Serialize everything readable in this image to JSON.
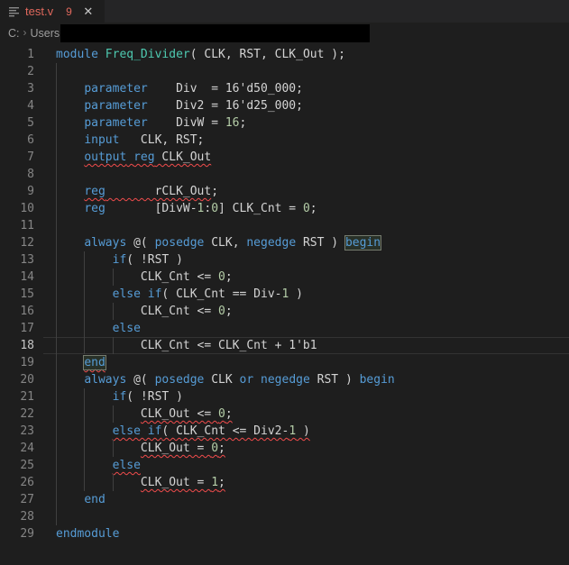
{
  "tab_bar": {
    "tab": {
      "file_name": "test.v",
      "problems_count": "9",
      "close_glyph": "✕"
    }
  },
  "breadcrumb": {
    "drive": "C:",
    "separator": "›",
    "folder": "Users",
    "redacted": true
  },
  "colors": {
    "editor_background": "#1e1e1e",
    "tab_bar_background": "#252526",
    "error_file_label": "#e0685c",
    "keyword": "#569cd6",
    "module_name": "#4ec9b0",
    "default_text": "#d4d4d4",
    "number": "#b5cea8",
    "squiggle": "#f14c4c",
    "line_number": "#858585",
    "line_number_active": "#c6c6c6",
    "indent_guide": "#404040"
  },
  "editor": {
    "language": "verilog",
    "current_line": 18,
    "lines": [
      {
        "n": 1,
        "ind": 0,
        "guides": 0,
        "tokens": [
          {
            "t": "module ",
            "c": "kw"
          },
          {
            "t": "Freq_Divider",
            "c": "fn"
          },
          {
            "t": "( CLK, RST, CLK_Out );",
            "c": "tx"
          }
        ]
      },
      {
        "n": 2,
        "ind": 0,
        "guides": 1,
        "tokens": []
      },
      {
        "n": 3,
        "ind": 4,
        "guides": 1,
        "tokens": [
          {
            "t": "parameter",
            "c": "kw"
          },
          {
            "t": "    Div  = 16'd50_000;",
            "c": "tx"
          }
        ]
      },
      {
        "n": 4,
        "ind": 4,
        "guides": 1,
        "tokens": [
          {
            "t": "parameter",
            "c": "kw"
          },
          {
            "t": "    Div2 = 16'd25_000;",
            "c": "tx"
          }
        ]
      },
      {
        "n": 5,
        "ind": 4,
        "guides": 1,
        "tokens": [
          {
            "t": "parameter",
            "c": "kw"
          },
          {
            "t": "    DivW = ",
            "c": "tx"
          },
          {
            "t": "16",
            "c": "nu"
          },
          {
            "t": ";",
            "c": "tx"
          }
        ]
      },
      {
        "n": 6,
        "ind": 4,
        "guides": 1,
        "tokens": [
          {
            "t": "input",
            "c": "kw"
          },
          {
            "t": "   CLK, RST;",
            "c": "tx"
          }
        ]
      },
      {
        "n": 7,
        "ind": 4,
        "guides": 1,
        "tokens": [
          {
            "t": "output",
            "c": "kw",
            "err": true
          },
          {
            "t": " ",
            "c": "tx",
            "err": true
          },
          {
            "t": "reg",
            "c": "kw",
            "err": true
          },
          {
            "t": " CLK_Out",
            "c": "tx",
            "err": true
          }
        ]
      },
      {
        "n": 8,
        "ind": 0,
        "guides": 1,
        "tokens": []
      },
      {
        "n": 9,
        "ind": 4,
        "guides": 1,
        "tokens": [
          {
            "t": "reg",
            "c": "kw",
            "err": true
          },
          {
            "t": "       rCLK_Out",
            "c": "tx",
            "err": true
          },
          {
            "t": ";",
            "c": "tx"
          }
        ]
      },
      {
        "n": 10,
        "ind": 4,
        "guides": 1,
        "tokens": [
          {
            "t": "reg",
            "c": "kw"
          },
          {
            "t": "       [DivW-",
            "c": "tx"
          },
          {
            "t": "1",
            "c": "nu"
          },
          {
            "t": ":",
            "c": "tx"
          },
          {
            "t": "0",
            "c": "nu"
          },
          {
            "t": "] CLK_Cnt = ",
            "c": "tx"
          },
          {
            "t": "0",
            "c": "nu"
          },
          {
            "t": ";",
            "c": "tx"
          }
        ]
      },
      {
        "n": 11,
        "ind": 0,
        "guides": 1,
        "tokens": []
      },
      {
        "n": 12,
        "ind": 4,
        "guides": 1,
        "tokens": [
          {
            "t": "always",
            "c": "kw"
          },
          {
            "t": " @( ",
            "c": "tx"
          },
          {
            "t": "posedge",
            "c": "kw"
          },
          {
            "t": " CLK, ",
            "c": "tx"
          },
          {
            "t": "negedge",
            "c": "kw"
          },
          {
            "t": " RST ) ",
            "c": "tx"
          },
          {
            "t": "begin",
            "c": "kw",
            "box": true
          }
        ]
      },
      {
        "n": 13,
        "ind": 8,
        "guides": 2,
        "tokens": [
          {
            "t": "if",
            "c": "kw"
          },
          {
            "t": "( !RST )",
            "c": "tx"
          }
        ]
      },
      {
        "n": 14,
        "ind": 12,
        "guides": 3,
        "tokens": [
          {
            "t": "CLK_Cnt <= ",
            "c": "tx"
          },
          {
            "t": "0",
            "c": "nu"
          },
          {
            "t": ";",
            "c": "tx"
          }
        ]
      },
      {
        "n": 15,
        "ind": 8,
        "guides": 2,
        "tokens": [
          {
            "t": "else if",
            "c": "kw"
          },
          {
            "t": "( CLK_Cnt == Div-",
            "c": "tx"
          },
          {
            "t": "1",
            "c": "nu"
          },
          {
            "t": " )",
            "c": "tx"
          }
        ]
      },
      {
        "n": 16,
        "ind": 12,
        "guides": 3,
        "tokens": [
          {
            "t": "CLK_Cnt <= ",
            "c": "tx"
          },
          {
            "t": "0",
            "c": "nu"
          },
          {
            "t": ";",
            "c": "tx"
          }
        ]
      },
      {
        "n": 17,
        "ind": 8,
        "guides": 2,
        "tokens": [
          {
            "t": "else",
            "c": "kw"
          }
        ]
      },
      {
        "n": 18,
        "ind": 12,
        "guides": 3,
        "tokens": [
          {
            "t": "CLK_Cnt <= CLK_Cnt + 1'b1",
            "c": "tx"
          }
        ]
      },
      {
        "n": 19,
        "ind": 4,
        "guides": 1,
        "tokens": [
          {
            "t": "end",
            "c": "kw",
            "err": true,
            "box": true
          }
        ]
      },
      {
        "n": 20,
        "ind": 4,
        "guides": 1,
        "tokens": [
          {
            "t": "always",
            "c": "kw"
          },
          {
            "t": " @( ",
            "c": "tx"
          },
          {
            "t": "posedge",
            "c": "kw"
          },
          {
            "t": " CLK ",
            "c": "tx"
          },
          {
            "t": "or",
            "c": "kw"
          },
          {
            "t": " ",
            "c": "tx"
          },
          {
            "t": "negedge",
            "c": "kw"
          },
          {
            "t": " RST ) ",
            "c": "tx"
          },
          {
            "t": "begin",
            "c": "kw"
          }
        ]
      },
      {
        "n": 21,
        "ind": 8,
        "guides": 2,
        "tokens": [
          {
            "t": "if",
            "c": "kw"
          },
          {
            "t": "( !RST )",
            "c": "tx"
          }
        ]
      },
      {
        "n": 22,
        "ind": 12,
        "guides": 3,
        "tokens": [
          {
            "t": "CLK_Out <= ",
            "c": "tx",
            "err": true
          },
          {
            "t": "0",
            "c": "nu",
            "err": true
          },
          {
            "t": ";",
            "c": "tx",
            "err": true
          }
        ]
      },
      {
        "n": 23,
        "ind": 8,
        "guides": 2,
        "tokens": [
          {
            "t": "else if",
            "c": "kw",
            "err": true
          },
          {
            "t": "( CLK_Cnt <= Div2-",
            "c": "tx",
            "err": true
          },
          {
            "t": "1",
            "c": "nu",
            "err": true
          },
          {
            "t": " )",
            "c": "tx",
            "err": true
          }
        ]
      },
      {
        "n": 24,
        "ind": 12,
        "guides": 3,
        "tokens": [
          {
            "t": "CLK_Out = ",
            "c": "tx",
            "err": true
          },
          {
            "t": "0",
            "c": "nu",
            "err": true
          },
          {
            "t": ";",
            "c": "tx",
            "err": true
          }
        ]
      },
      {
        "n": 25,
        "ind": 8,
        "guides": 2,
        "tokens": [
          {
            "t": "else",
            "c": "kw",
            "err": true
          }
        ]
      },
      {
        "n": 26,
        "ind": 12,
        "guides": 3,
        "tokens": [
          {
            "t": "CLK_Out = ",
            "c": "tx",
            "err": true
          },
          {
            "t": "1",
            "c": "nu",
            "err": true
          },
          {
            "t": ";",
            "c": "tx",
            "err": true
          }
        ]
      },
      {
        "n": 27,
        "ind": 4,
        "guides": 1,
        "tokens": [
          {
            "t": "end",
            "c": "kw"
          }
        ]
      },
      {
        "n": 28,
        "ind": 0,
        "guides": 1,
        "tokens": []
      },
      {
        "n": 29,
        "ind": 0,
        "guides": 0,
        "tokens": [
          {
            "t": "endmodule",
            "c": "kw"
          }
        ]
      }
    ]
  }
}
